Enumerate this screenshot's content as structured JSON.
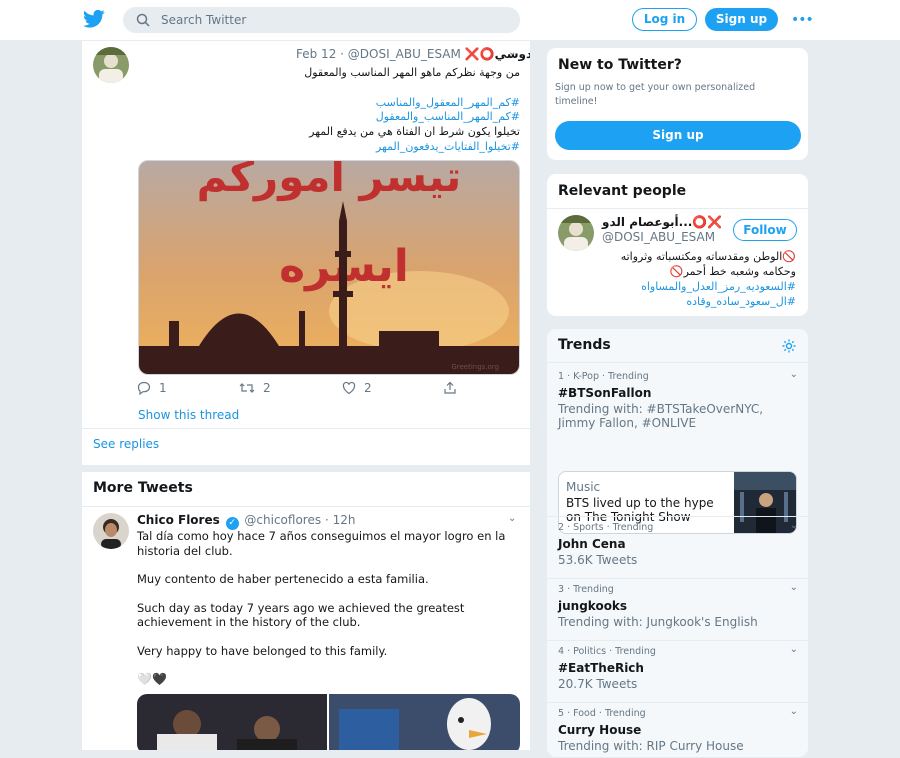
{
  "colors": {
    "accent": "#1da1f2",
    "link": "#1b95e0",
    "background": "#e6ecf0",
    "danger": "#e0245e"
  },
  "header": {
    "search_placeholder": "Search Twitter",
    "login": "Log in",
    "signup": "Sign up",
    "more": "•••"
  },
  "tweet": {
    "name": "أبوعصام الدوسي",
    "name_emoji_left": "❌⭕",
    "name_emoji_right": "⭕❌",
    "handle": "@DOSI_ABU_ESAM",
    "date": "Feb 12",
    "text_lines": [
      "من وجهة نظركم ماهو المهر المناسب والمعقول"
    ],
    "hashtags": [
      "#كم_المهر_المعقول_والمناسب",
      "#كم_المهر_المناسب_والمعقول"
    ],
    "text2": "تخيلوا يكون شرط ان الفتاة هي من يدفع المهر",
    "hashtag3": "#تخيلوا_الفتايات_يدفعون_المهر",
    "image_text_top": "تيسر اموركم",
    "image_text_mid": "ايسره",
    "image_watermark": "Greetings.org",
    "replies": "1",
    "retweets": "2",
    "likes": "2",
    "show_thread": "Show this thread",
    "see_replies": "See replies"
  },
  "more_tweets": {
    "heading": "More Tweets",
    "tweet": {
      "name": "Chico Flores",
      "handle": "@chicoflores",
      "time": "· 12h",
      "verified": "✓",
      "paragraphs": [
        "Tal día como hoy hace 7 años conseguimos el mayor logro en la historia del club.",
        "Muy contento de haber pertenecido a esta familia.",
        "Such day as today 7 years ago we achieved the greatest achievement in the history of the club.",
        "Very happy to have belonged to this family."
      ],
      "hearts": "🤍🖤"
    }
  },
  "new_to_twitter": {
    "title": "New to Twitter?",
    "subtitle": "Sign up now to get your own personalized timeline!",
    "button": "Sign up"
  },
  "relevant_people": {
    "title": "Relevant people",
    "name": "أبوعصام الدو...",
    "name_emoji": "⭕❌",
    "handle": "@DOSI_ABU_ESAM",
    "follow": "Follow",
    "bio_line1": "🚫الوطن ومقدساته ومكتسباته وثرواته",
    "bio_line2": "وحكامه وشعبه خط أحمر🚫",
    "bio_tag1": "#السعوديه_رمز_العدل_والمساواه",
    "bio_tag2": "#ال_سعود_ساده_وقاده"
  },
  "trends": {
    "title": "Trends",
    "items": [
      {
        "meta": "1 · K-Pop · Trending",
        "name": "#BTSonFallon",
        "sub": "Trending with: #BTSTakeOverNYC, Jimmy Fallon, #ONLIVE"
      },
      {
        "meta": "2 · Sports · Trending",
        "name": "John Cena",
        "sub": "53.6K Tweets"
      },
      {
        "meta": "3 · Trending",
        "name": "jungkooks",
        "sub": "Trending with: Jungkook's English"
      },
      {
        "meta": "4 · Politics · Trending",
        "name": "#EatTheRich",
        "sub": "20.7K Tweets"
      },
      {
        "meta": "5 · Food · Trending",
        "name": "Curry House",
        "sub": "Trending with: RIP Curry House"
      }
    ],
    "card": {
      "category": "Music",
      "headline": "BTS lived up to the hype on The Tonight Show"
    }
  }
}
